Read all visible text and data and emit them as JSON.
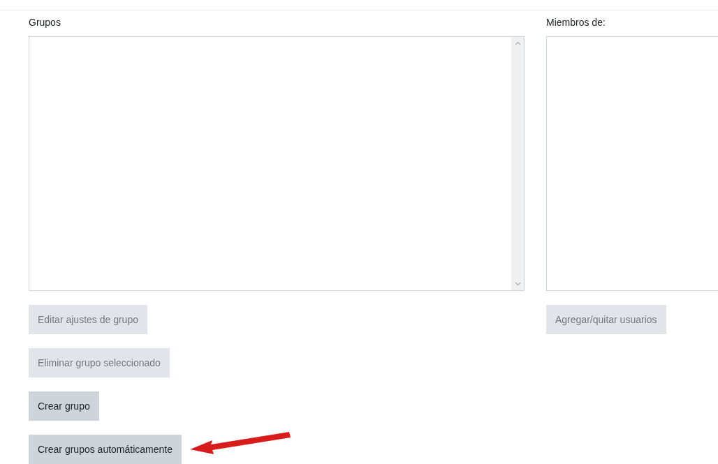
{
  "groups_panel": {
    "label": "Grupos",
    "buttons": [
      {
        "label": "Editar ajustes de grupo",
        "disabled": true
      },
      {
        "label": "Eliminar grupo seleccionado",
        "disabled": true
      },
      {
        "label": "Crear grupo",
        "disabled": false
      },
      {
        "label": "Crear grupos automáticamente",
        "disabled": false
      }
    ]
  },
  "members_panel": {
    "label": "Miembros de:",
    "buttons": [
      {
        "label": "Agregar/quitar usuarios",
        "disabled": true
      }
    ]
  }
}
